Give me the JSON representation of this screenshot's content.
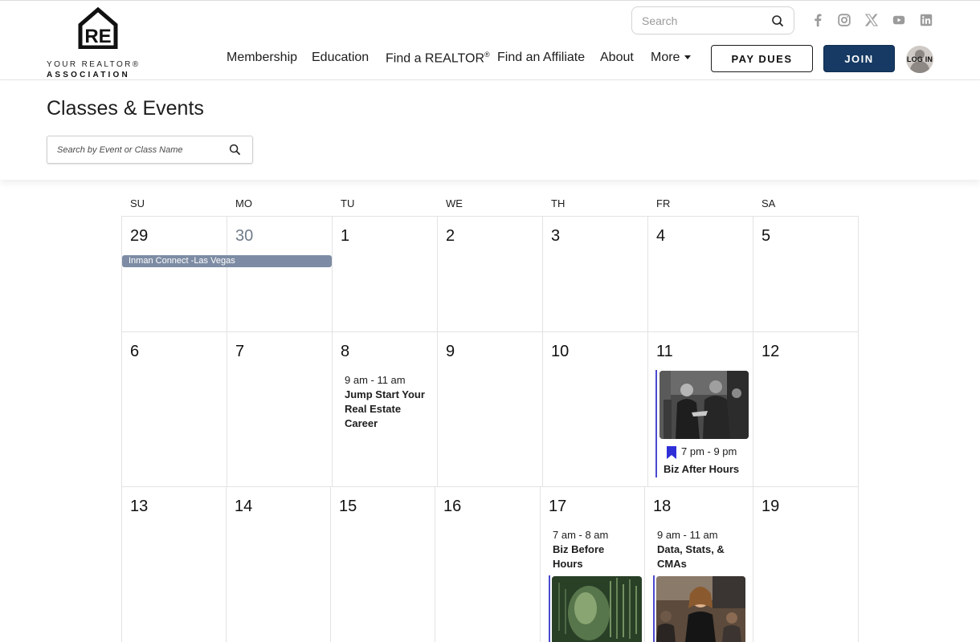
{
  "logo": {
    "mark": "RE",
    "line1": "YOUR REALTOR®",
    "line2": "ASSOCIATION"
  },
  "header": {
    "search_placeholder": "Search",
    "social_icons": [
      "facebook-icon",
      "instagram-icon",
      "x-icon",
      "youtube-icon",
      "linkedin-icon"
    ],
    "nav": {
      "membership": "Membership",
      "education": "Education",
      "find_realtor": "Find a REALTOR",
      "find_realtor_sup": "®",
      "find_affiliate": "Find an Affiliate",
      "about": "About",
      "more": "More"
    },
    "pay_dues": "PAY DUES",
    "join": "JOIN",
    "login": "LOG IN"
  },
  "page": {
    "title": "Classes & Events",
    "search_placeholder": "Search by Event or Class Name"
  },
  "calendar": {
    "days_of_week": [
      "SU",
      "MO",
      "TU",
      "WE",
      "TH",
      "FR",
      "SA"
    ],
    "weeks": [
      [
        "29",
        "30",
        "1",
        "2",
        "3",
        "4",
        "5"
      ],
      [
        "6",
        "7",
        "8",
        "9",
        "10",
        "11",
        "12"
      ],
      [
        "13",
        "14",
        "15",
        "16",
        "17",
        "18",
        "19"
      ]
    ],
    "muted_days": [
      "30"
    ],
    "events": {
      "inman": {
        "title": "Inman Connect -Las Vegas"
      },
      "jumpstart": {
        "time": "9 am - 11 am",
        "title": "Jump Start Your Real Estate Career"
      },
      "biz_after": {
        "time": "7 pm - 9 pm",
        "title": "Biz After Hours"
      },
      "biz_before": {
        "time": "7 am - 8 am",
        "title": "Biz Before Hours"
      },
      "data_stats": {
        "time": "9 am - 11 am",
        "title": "Data, Stats, & CMAs"
      }
    }
  },
  "colors": {
    "join_bg": "#163a63",
    "multi_event_bg": "#7d8ca4",
    "event_accent": "#4a4acf",
    "bookmark": "#2f2fd8"
  }
}
